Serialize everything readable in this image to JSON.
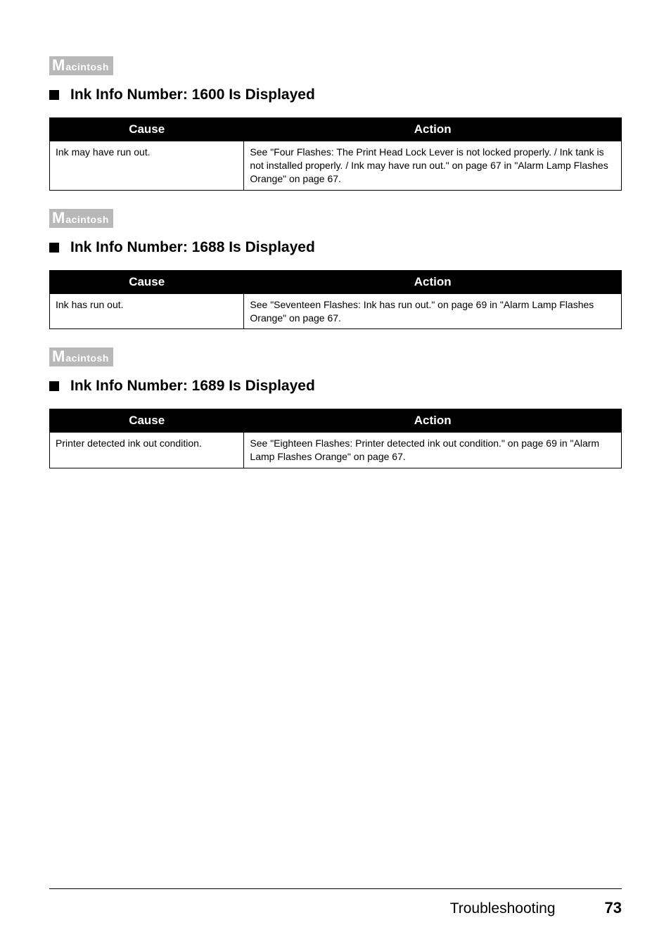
{
  "os_badges": {
    "mac_big": "M",
    "mac_rest": "acintosh"
  },
  "table_headers": {
    "cause": "Cause",
    "action": "Action"
  },
  "sections": [
    {
      "heading": "Ink Info Number: 1600 Is Displayed",
      "cause": "Ink may have run out.",
      "action": "See \"Four Flashes: The Print Head Lock Lever is not locked properly. / Ink tank is not installed properly. / Ink may have run out.\" on page 67 in \"Alarm Lamp Flashes Orange\" on page 67."
    },
    {
      "heading": "Ink Info Number: 1688 Is Displayed",
      "cause": "Ink has run out.",
      "action": "See \"Seventeen Flashes: Ink has run out.\" on page 69 in \"Alarm Lamp Flashes Orange\" on page 67."
    },
    {
      "heading": "Ink Info Number: 1689 Is Displayed",
      "cause": "Printer detected ink out condition.",
      "action": "See \"Eighteen Flashes: Printer detected ink out condition.\" on page 69 in \"Alarm Lamp Flashes Orange\" on page 67."
    }
  ],
  "footer": {
    "section": "Troubleshooting",
    "page": "73"
  }
}
